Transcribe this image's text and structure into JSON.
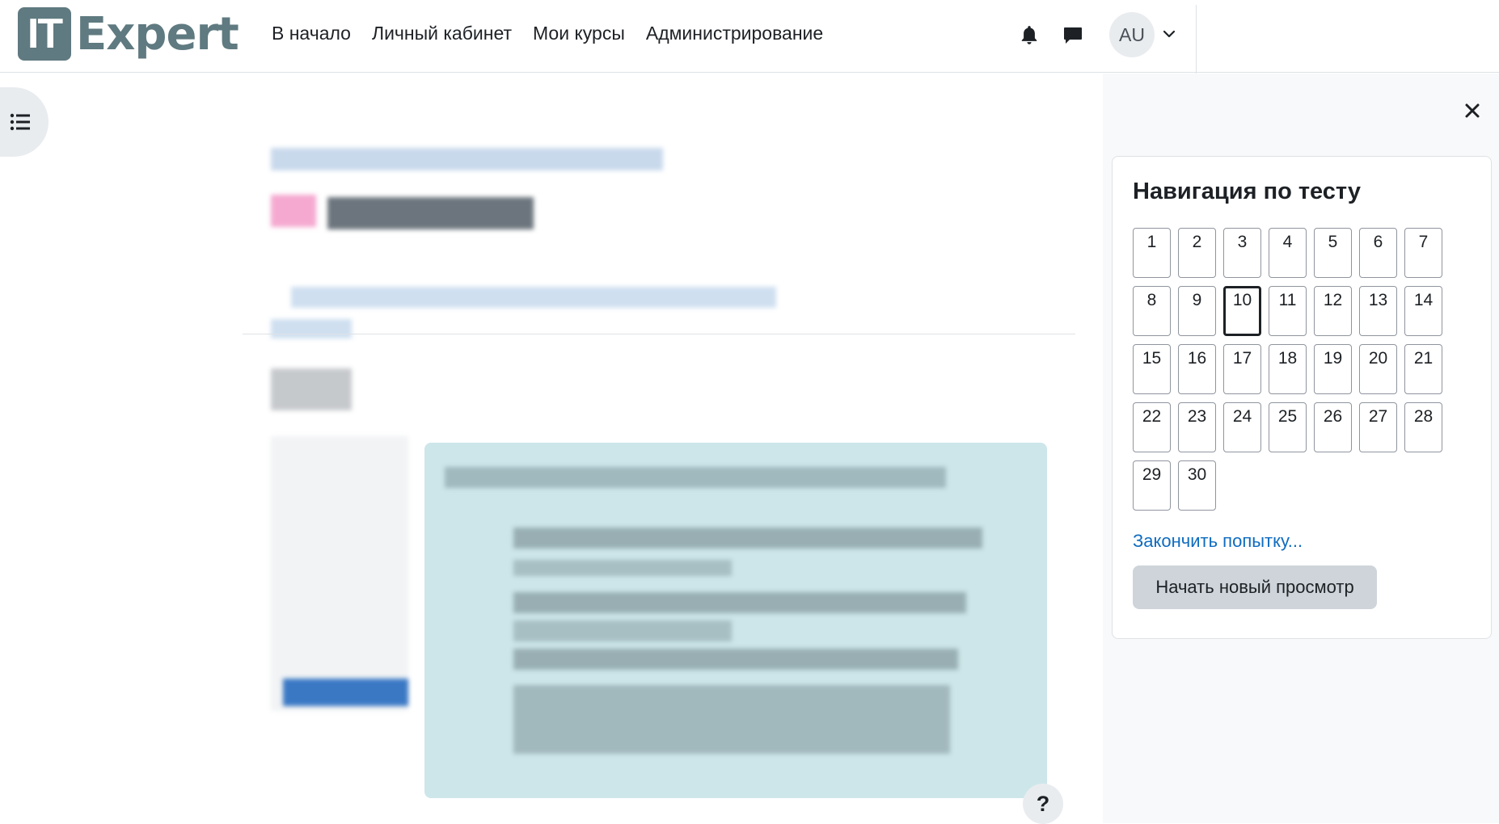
{
  "logo": {
    "it": "IT",
    "text": "Expert"
  },
  "nav": {
    "links": [
      "В начало",
      "Личный кабинет",
      "Мои курсы",
      "Администрирование"
    ],
    "avatar_initials": "AU"
  },
  "quiz_nav": {
    "title": "Навигация по тесту",
    "questions": [
      "1",
      "2",
      "3",
      "4",
      "5",
      "6",
      "7",
      "8",
      "9",
      "10",
      "11",
      "12",
      "13",
      "14",
      "15",
      "16",
      "17",
      "18",
      "19",
      "20",
      "21",
      "22",
      "23",
      "24",
      "25",
      "26",
      "27",
      "28",
      "29",
      "30"
    ],
    "current_question": "10",
    "finish_link": "Закончить попытку...",
    "new_preview_button": "Начать новый просмотр"
  },
  "help": {
    "label": "?"
  }
}
